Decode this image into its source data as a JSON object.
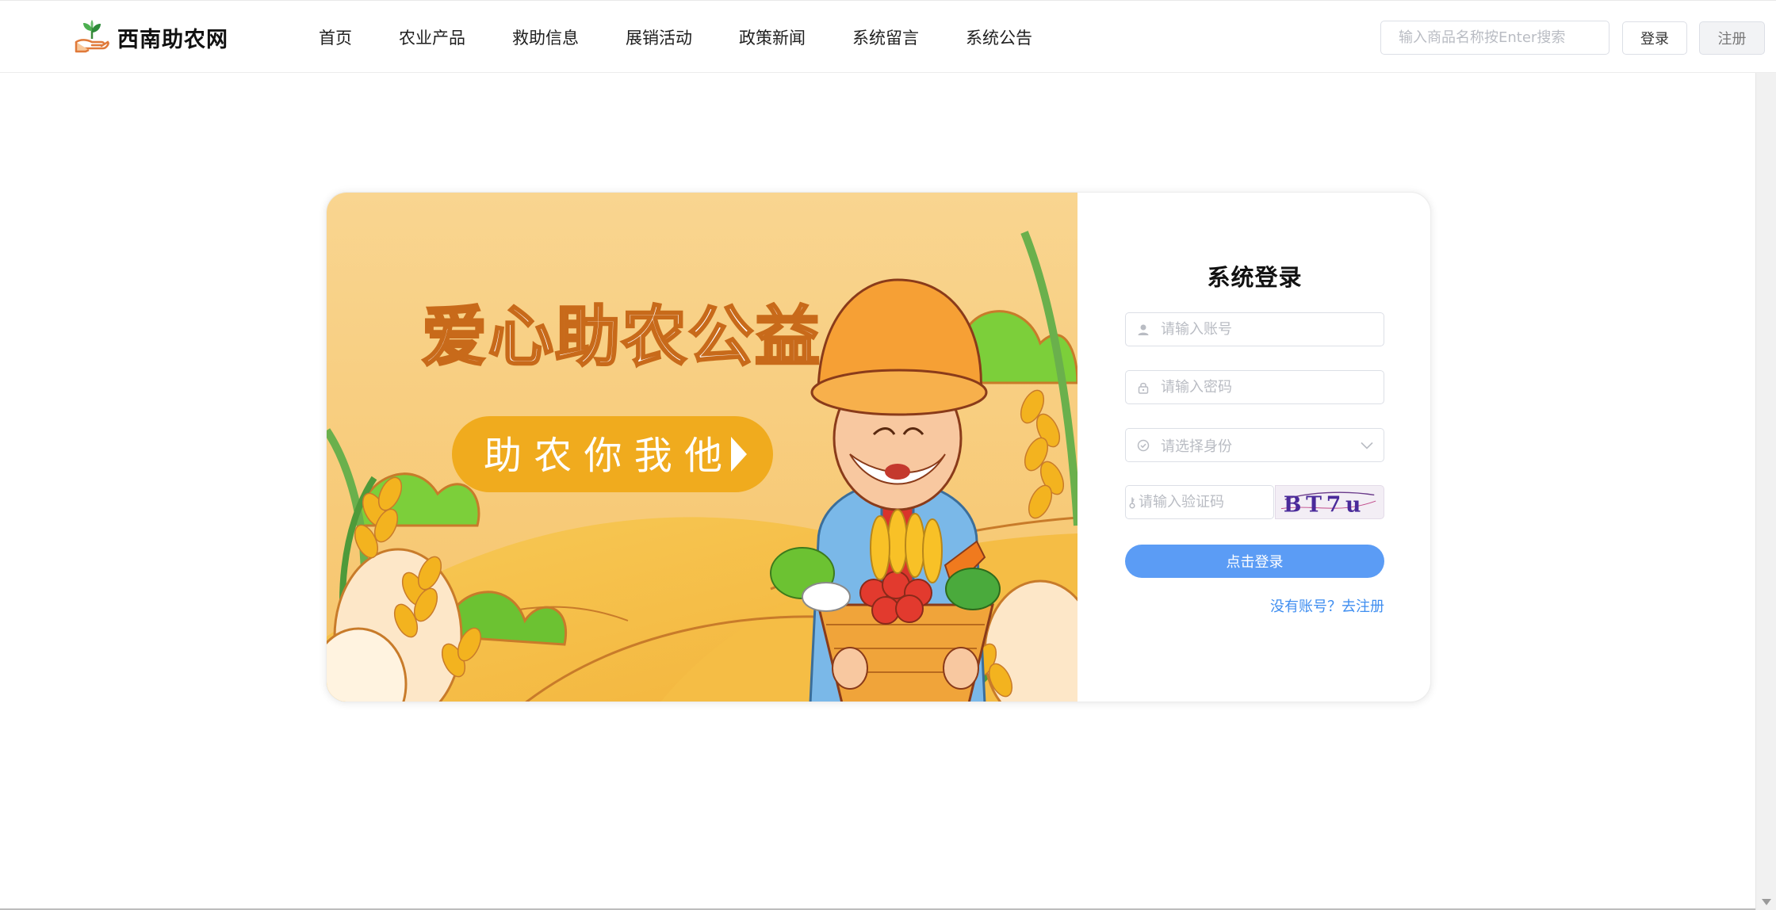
{
  "header": {
    "brand_name": "西南助农网",
    "nav": [
      "首页",
      "农业产品",
      "救助信息",
      "展销活动",
      "政策新闻",
      "系统留言",
      "系统公告"
    ],
    "search_placeholder": "输入商品名称按Enter搜索",
    "login_label": "登录",
    "register_label": "注册"
  },
  "banner": {
    "headline": "爱心助农公益",
    "button_text": "助 农 你 我 他"
  },
  "login_form": {
    "title": "系统登录",
    "account_placeholder": "请输入账号",
    "password_placeholder": "请输入密码",
    "role_placeholder": "请选择身份",
    "captcha_placeholder": "请输入验证码",
    "captcha_text": "BT7u",
    "submit_label": "点击登录",
    "register_link": "没有账号？去注册"
  },
  "icons": {
    "account": "user-icon",
    "password": "lock-icon",
    "role": "check-circle-icon",
    "captcha": "key-icon",
    "dropdown": "chevron-down-icon"
  },
  "colors": {
    "primary_button": "#5b9cf5",
    "link": "#3f8ef0",
    "banner_bg": "#f7d08a",
    "banner_accent": "#f0ab1e"
  }
}
